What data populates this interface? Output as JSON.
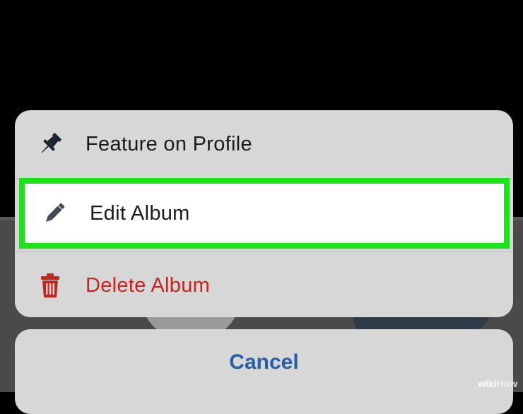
{
  "action_sheet": {
    "items": [
      {
        "label": "Feature on Profile",
        "icon": "pin-icon"
      },
      {
        "label": "Edit Album",
        "icon": "pencil-icon",
        "highlighted": true
      },
      {
        "label": "Delete Album",
        "icon": "trash-icon",
        "destructive": true
      }
    ]
  },
  "cancel": {
    "label": "Cancel"
  },
  "colors": {
    "sheet_bg": "#d7d7d7",
    "highlight_border": "#19e619",
    "destructive": "#c8241e",
    "cancel": "#2a5fa8"
  },
  "watermark": {
    "prefix": "wiki",
    "suffix": "How"
  }
}
